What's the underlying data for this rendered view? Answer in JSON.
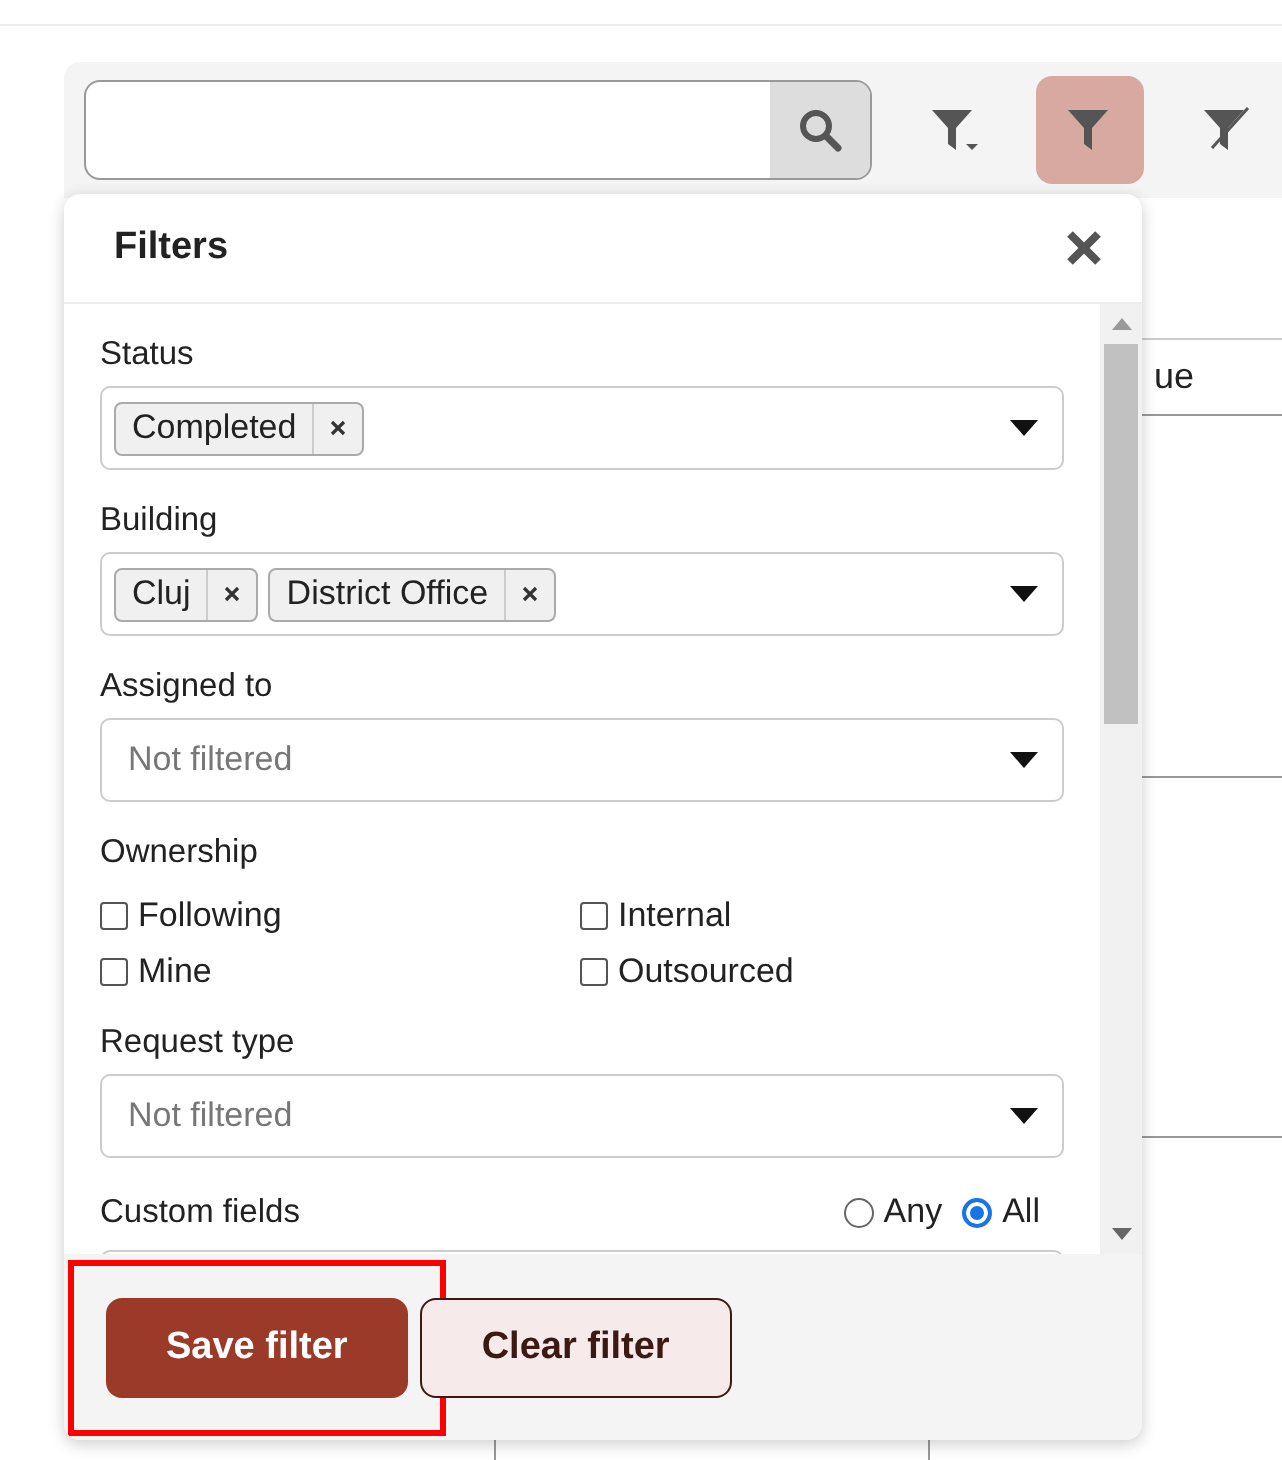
{
  "toolbar": {
    "buttons": [
      {
        "kind": "filter-menu",
        "selected": false
      },
      {
        "kind": "filter",
        "selected": true
      },
      {
        "kind": "clear-filter",
        "selected": false
      }
    ]
  },
  "table": {
    "column_3": "ue"
  },
  "filters": {
    "title": "Filters",
    "fields": [
      {
        "kind": "multiselect",
        "label": "Status",
        "tags": [
          "Completed"
        ]
      },
      {
        "kind": "multiselect",
        "label": "Building",
        "tags": [
          "Cluj",
          "District Office"
        ]
      },
      {
        "kind": "select",
        "label": "Assigned to",
        "placeholder": "Not filtered"
      },
      {
        "kind": "checkboxes",
        "label": "Ownership",
        "options": [
          {
            "label": "Following",
            "checked": false
          },
          {
            "label": "Internal",
            "checked": false
          },
          {
            "label": "Mine",
            "checked": false
          },
          {
            "label": "Outsourced",
            "checked": false
          }
        ]
      },
      {
        "kind": "select",
        "label": "Request type",
        "placeholder": "Not filtered"
      },
      {
        "kind": "radios",
        "label": "Custom fields",
        "options": [
          {
            "label": "Any",
            "selected": false
          },
          {
            "label": "All",
            "selected": true
          }
        ]
      }
    ],
    "buttons": [
      {
        "kind": "primary",
        "label": "Save filter",
        "highlighted": true
      },
      {
        "kind": "secondary",
        "label": "Clear filter",
        "highlighted": false
      }
    ]
  }
}
